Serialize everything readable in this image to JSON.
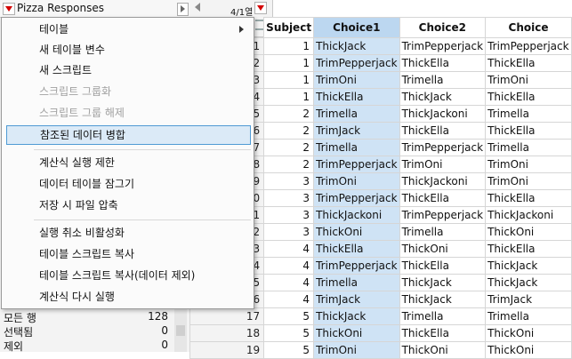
{
  "panel": {
    "title": "Pizza Responses"
  },
  "topbar": {
    "col_count": "4/1열"
  },
  "rows_summary": [
    {
      "label": "모든 행",
      "value": "128"
    },
    {
      "label": "선택됨",
      "value": "0"
    },
    {
      "label": "제외",
      "value": "0"
    }
  ],
  "table": {
    "headers": [
      "Subject",
      "Choice1",
      "Choice2",
      "Choice"
    ],
    "rows": [
      [
        "1",
        "1",
        "ThickJack",
        "TrimPepperjack",
        "TrimPepperjack"
      ],
      [
        "2",
        "1",
        "TrimPepperjack",
        "ThickElla",
        "ThickElla"
      ],
      [
        "3",
        "1",
        "TrimOni",
        "Trimella",
        "TrimOni"
      ],
      [
        "4",
        "1",
        "ThickElla",
        "ThickJack",
        "ThickElla"
      ],
      [
        "5",
        "2",
        "Trimella",
        "ThickJackoni",
        "Trimella"
      ],
      [
        "6",
        "2",
        "TrimJack",
        "ThickElla",
        "ThickElla"
      ],
      [
        "7",
        "2",
        "Trimella",
        "TrimPepperjack",
        "Trimella"
      ],
      [
        "8",
        "2",
        "TrimPepperjack",
        "TrimOni",
        "TrimOni"
      ],
      [
        "9",
        "3",
        "TrimOni",
        "ThickJackoni",
        "TrimOni"
      ],
      [
        "10",
        "3",
        "TrimPepperjack",
        "ThickElla",
        "ThickElla"
      ],
      [
        "11",
        "3",
        "ThickJackoni",
        "TrimPepperjack",
        "ThickJackoni"
      ],
      [
        "12",
        "3",
        "ThickOni",
        "Trimella",
        "ThickOni"
      ],
      [
        "13",
        "4",
        "ThickElla",
        "ThickOni",
        "ThickElla"
      ],
      [
        "14",
        "4",
        "TrimPepperjack",
        "ThickElla",
        "ThickJack"
      ],
      [
        "15",
        "4",
        "Trimella",
        "ThickJack",
        "ThickJack"
      ],
      [
        "16",
        "4",
        "TrimJack",
        "ThickJack",
        "TrimJack"
      ],
      [
        "17",
        "5",
        "ThickJack",
        "Trimella",
        "Trimella"
      ],
      [
        "18",
        "5",
        "ThickOni",
        "ThickElla",
        "ThickOni"
      ],
      [
        "19",
        "5",
        "TrimOni",
        "ThickOni",
        "ThickOni"
      ]
    ]
  },
  "menu": {
    "items": [
      {
        "label": "테이블",
        "disabled": false,
        "submenu": true
      },
      {
        "label": "새 테이블 변수",
        "disabled": false
      },
      {
        "label": "새 스크립트",
        "disabled": false
      },
      {
        "label": "스크립트 그룹화",
        "disabled": true
      },
      {
        "label": "스크립트 그룹 해제",
        "disabled": true
      },
      {
        "label": "참조된 데이터 병합",
        "disabled": false,
        "highlighted": true
      },
      {
        "label": "계산식 실행 제한",
        "disabled": false
      },
      {
        "label": "데이터 테이블 잠그기",
        "disabled": false
      },
      {
        "label": "저장 시 파일 압축",
        "disabled": false
      },
      {
        "label": "실행 취소 비활성화",
        "disabled": false
      },
      {
        "label": "테이블 스크립트 복사",
        "disabled": false
      },
      {
        "label": "테이블 스크립트 복사(데이터 제외)",
        "disabled": false
      },
      {
        "label": "계산식 다시 실행",
        "disabled": false
      }
    ]
  },
  "colors": {
    "selected_column": "#cfe3f5",
    "highlight_border": "#4f9ad4",
    "red_triangle": "#d40000"
  }
}
